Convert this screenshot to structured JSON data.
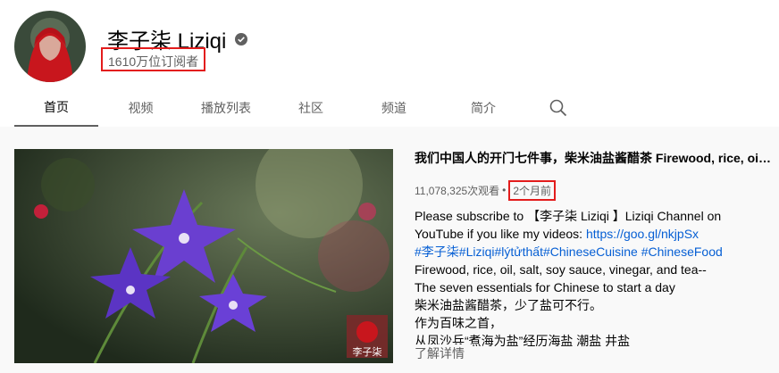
{
  "channel": {
    "name": "李子柒 Liziqi",
    "subscribers": "1610万位订阅者"
  },
  "tabs": [
    {
      "label": "首页",
      "active": true
    },
    {
      "label": "视频"
    },
    {
      "label": "播放列表"
    },
    {
      "label": "社区"
    },
    {
      "label": "频道"
    },
    {
      "label": "简介"
    }
  ],
  "video": {
    "title": "我们中国人的开门七件事，柴米油盐酱醋茶 Firewood, rice, oil, salt, soy sauce, vinegar, and tea",
    "views": "11,078,325次观看",
    "separator": "•",
    "date": "2个月前",
    "thumb_watermark": "李子柒",
    "description": {
      "line1": "Please  subscribe to 【李子柒 Liziqi 】Liziqi Channel on",
      "line2_prefix": "YouTube if you like my videos: ",
      "line2_link": "https://goo.gl/nkjpSx",
      "hashtags": "#李子柒#Liziqi#lýtửthất#ChineseCuisine #ChineseFood",
      "line4": "Firewood, rice, oil, salt, soy sauce, vinegar, and tea--",
      "line5": "The seven essentials for Chinese to start a day",
      "line6": "柴米油盐酱醋茶，少了盐可不行。",
      "line7": "作为百味之首，",
      "line8": "从凤沙兵“煮海为盐”经历海盐 潮盐 井盐"
    },
    "more_label": "了解详情"
  },
  "colors": {
    "highlight": "#e31c1c",
    "link": "#065fd4",
    "flower": "#6a3fd0"
  }
}
